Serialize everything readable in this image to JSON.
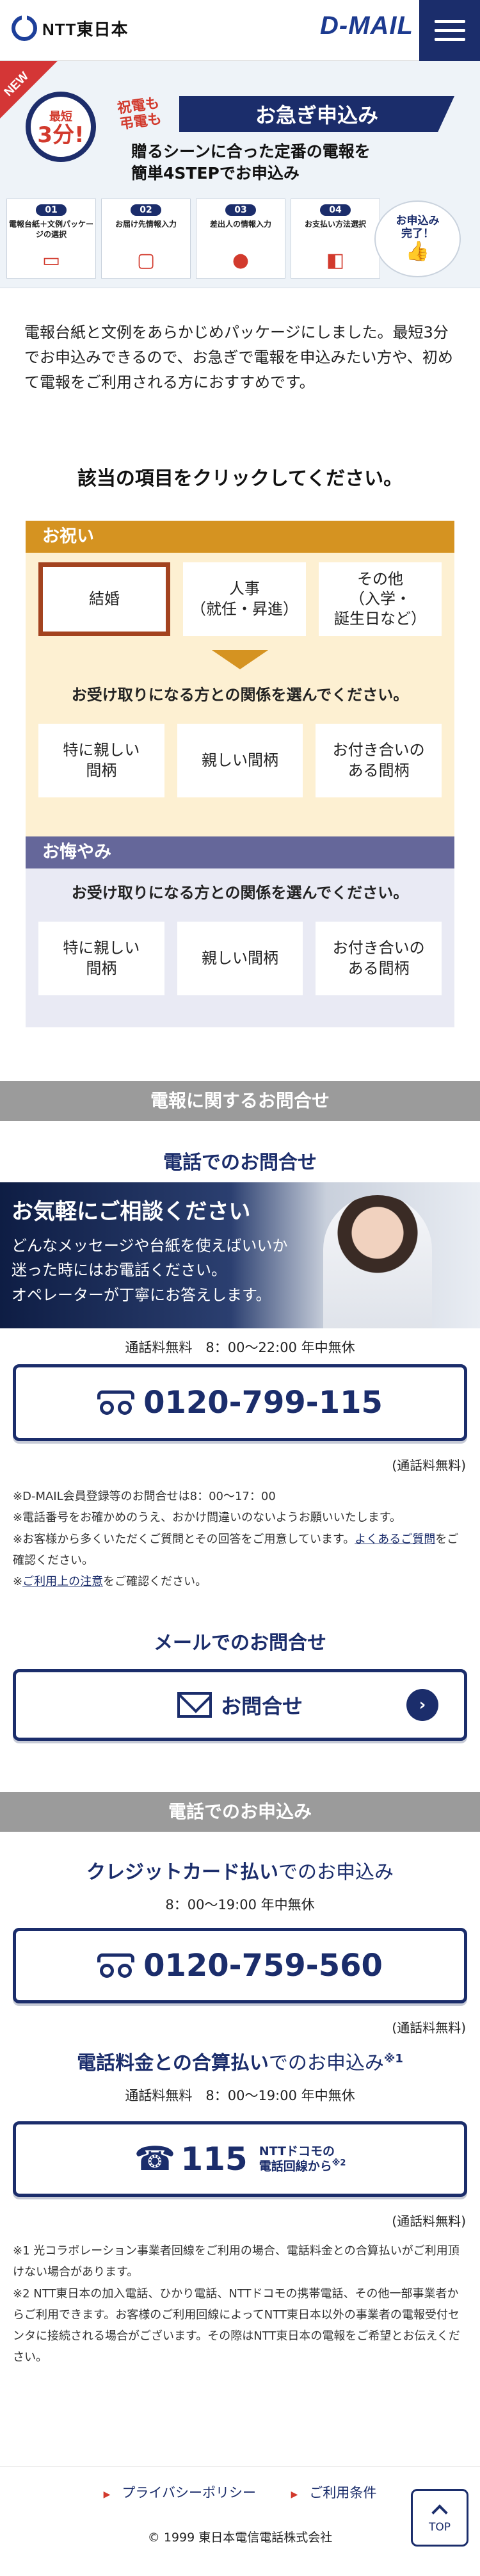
{
  "header": {
    "ntt_logo": "NTT東日本",
    "dmail_logo": "D-MAIL",
    "menu_icon": "hamburger-menu-icon"
  },
  "hero": {
    "new_badge": "NEW",
    "clock_line1": "最短",
    "clock_line2": "3分!",
    "sub_line1": "祝電も",
    "sub_line2": "弔電も",
    "title": "お急ぎ申込み",
    "desc_line1": "贈るシーンに合った定番の電報を",
    "desc_line2": "簡単4STEPでお申込み",
    "steps": [
      {
        "num": "01",
        "label": "電報台紙＋文例パッケージの選択",
        "icon": "card-icon"
      },
      {
        "num": "02",
        "label": "お届け先情報入力",
        "icon": "monitor-icon"
      },
      {
        "num": "03",
        "label": "差出人の情報入力",
        "icon": "person-icon"
      },
      {
        "num": "04",
        "label": "お支払い方法選択",
        "icon": "wallet-icon"
      }
    ],
    "done_line1": "お申込み",
    "done_line2": "完了！",
    "done_icon": "thumbs-up-icon"
  },
  "intro": "電報台紙と文例をあらかじめパッケージにしました。最短3分でお申込みできるので、お急ぎで電報を申込みたい方や、初めて電報をご利用される方におすすめです。",
  "select_heading": "該当の項目をクリックしてください。",
  "celebration": {
    "title": "お祝い",
    "color": "#d59321",
    "occasions": [
      "結婚",
      "人事\n（就任・昇進）",
      "その他\n（入学・\n誕生日など）"
    ],
    "selected": "結婚",
    "question": "お受け取りになる方との関係を選んでください。",
    "relations": [
      "特に親しい\n間柄",
      "親しい間柄",
      "お付き合いの\nある間柄"
    ]
  },
  "condolence": {
    "title": "お悔やみ",
    "color": "#65679a",
    "question": "お受け取りになる方との関係を選んでください。",
    "relations": [
      "特に親しい\n間柄",
      "親しい間柄",
      "お付き合いの\nある間柄"
    ]
  },
  "inquiry": {
    "band": "電報に関するお問合せ",
    "phone_title": "電話でのお問合せ",
    "photo_title": "お気軽にご相談ください",
    "photo_text_1": "どんなメッセージや台紙を使えばいいか",
    "photo_text_2": "迷った時にはお電話ください。",
    "photo_text_3": "オペレーターが丁寧にお答えします。",
    "hours": "通話料無料　8：00〜22:00 年中無休",
    "tel": "0120-799-115",
    "tel_note": "(通話料無料)",
    "note_1": "※D-MAIL会員登録等のお問合せは8：00〜17：00",
    "note_2": "※電話番号をお確かめのうえ、おかけ間違いのないようお願いいたします。",
    "note_3a": "※お客様から多くいただくご質問とその回答をご用意しています。",
    "note_3_link": "よくあるご質問",
    "note_3b": "をご確認ください。",
    "note_4_link": "ご利用上の注意",
    "note_4a": "※",
    "note_4b": "をご確認ください。",
    "mail_title": "メールでのお問合せ",
    "mail_button": "お問合せ"
  },
  "phone_order": {
    "band": "電話でのお申込み",
    "credit_title_bold": "クレジットカード払い",
    "credit_title_rest": "でのお申込み",
    "credit_hours": "8：00〜19:00 年中無休",
    "credit_tel": "0120-759-560",
    "credit_note": "(通話料無料)",
    "bill_title_bold": "電話料金との合算払い",
    "bill_title_rest": "でのお申込み",
    "bill_sup": "※1",
    "bill_hours": "通話料無料　8：00〜19:00 年中無休",
    "bill_tel": "115",
    "bill_tel_sub_1": "NTTドコモの",
    "bill_tel_sub_2": "電話回線から",
    "bill_tel_sup": "※2",
    "bill_note": "(通話料無料)",
    "fn_1": "※1 光コラボレーション事業者回線をご利用の場合、電話料金との合算払いがご利用頂けない場合があります。",
    "fn_2": "※2 NTT東日本の加入電話、ひかり電話、NTTドコモの携帯電話、その他一部事業者からご利用できます。お客様のご利用回線によってNTT東日本以外の事業者の電報受付センタに接続される場合がございます。その際はNTT東日本の電報をご希望とお伝えください。"
  },
  "footer": {
    "privacy": "プライバシーポリシー",
    "terms": "ご利用条件",
    "copyright": "© 1999 東日本電信電話株式会社",
    "top": "TOP"
  }
}
